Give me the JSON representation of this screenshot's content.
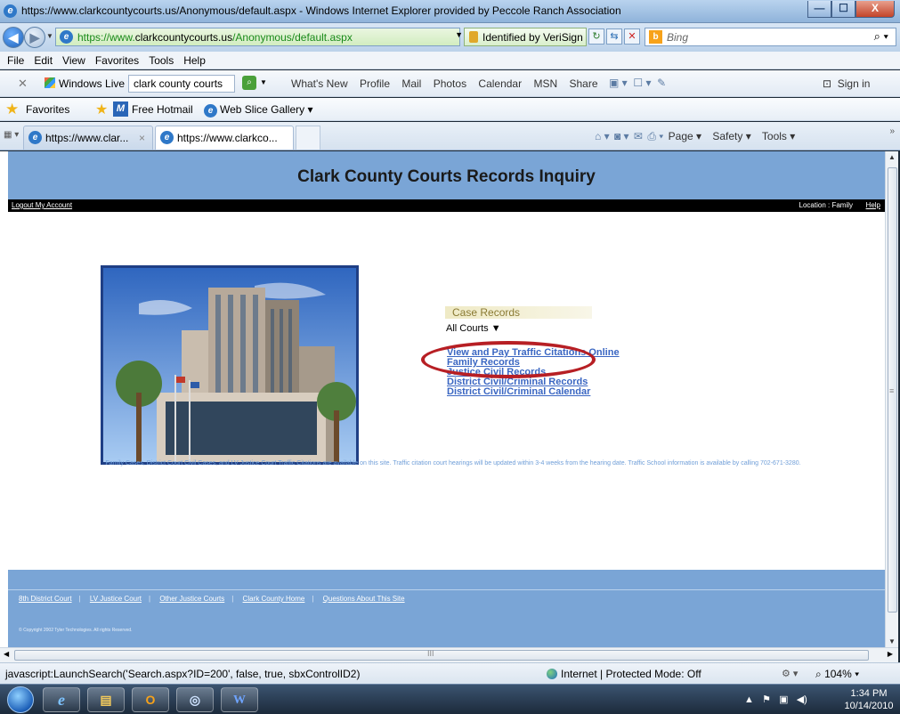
{
  "window": {
    "title": "https://www.clarkcountycourts.us/Anonymous/default.aspx - Windows Internet Explorer provided by Peccole Ranch Association",
    "minimize_glyph": "—",
    "maximize_glyph": "☐",
    "close_glyph": "X"
  },
  "address": {
    "url_prefix": "https://www.",
    "url_domain": "clarkcountycourts.us",
    "url_path": "/Anonymous/default.aspx",
    "identity": "Identified by VeriSign",
    "search_placeholder": "Bing"
  },
  "menu": [
    "File",
    "Edit",
    "View",
    "Favorites",
    "Tools",
    "Help"
  ],
  "windows_live": {
    "label": "Windows Live",
    "search_value": "clark county courts",
    "links": [
      "What's New",
      "Profile",
      "Mail",
      "Photos",
      "Calendar",
      "MSN",
      "Share"
    ],
    "sign_in": "Sign in"
  },
  "favorites": {
    "label": "Favorites",
    "hotmail": "Free Hotmail",
    "web_slice": "Web Slice Gallery ▾"
  },
  "tabs": [
    {
      "label": "https://www.clar...",
      "close": "×"
    },
    {
      "label": "https://www.clarkco..."
    }
  ],
  "command_bar": [
    "Page ▾",
    "Safety ▾",
    "Tools ▾"
  ],
  "page": {
    "title": "Clark County Courts Records Inquiry",
    "logout": "Logout My Account",
    "location": "Location : Family",
    "help": "Help",
    "case_records_heading": "Case Records",
    "court_select_value": "All Courts",
    "links": [
      "View and Pay Traffic Citations Online",
      "Family Records",
      "Justice Civil Records",
      "District Civil/Criminal Records",
      "District Civil/Criminal Calendar"
    ],
    "notice": "Family Cases, District Court Civil Cases, and LV Justice Court Traffic Citations are available on this site. Traffic citation court hearings will be updated within 3-4 weeks from the hearing date. Traffic School information is available by calling 702-671-3280.",
    "footer_links": [
      "8th District Court",
      "LV Justice Court",
      "Other Justice Courts",
      "Clark County Home",
      "Questions About This Site"
    ],
    "copyright": "© Copyright 2002 Tyler Technologies. All rights Reserved."
  },
  "status": {
    "text": "javascript:LaunchSearch('Search.aspx?ID=200', false, true, sbxControlID2)",
    "zone": "Internet | Protected Mode: Off",
    "zoom": "104%"
  },
  "taskbar": {
    "time": "1:34 PM",
    "date": "10/14/2010",
    "word_label": "W"
  },
  "colors": {
    "header_blue": "#7aa5d6",
    "link_blue": "#3a66c2",
    "highlight_oval": "#b71f24"
  }
}
